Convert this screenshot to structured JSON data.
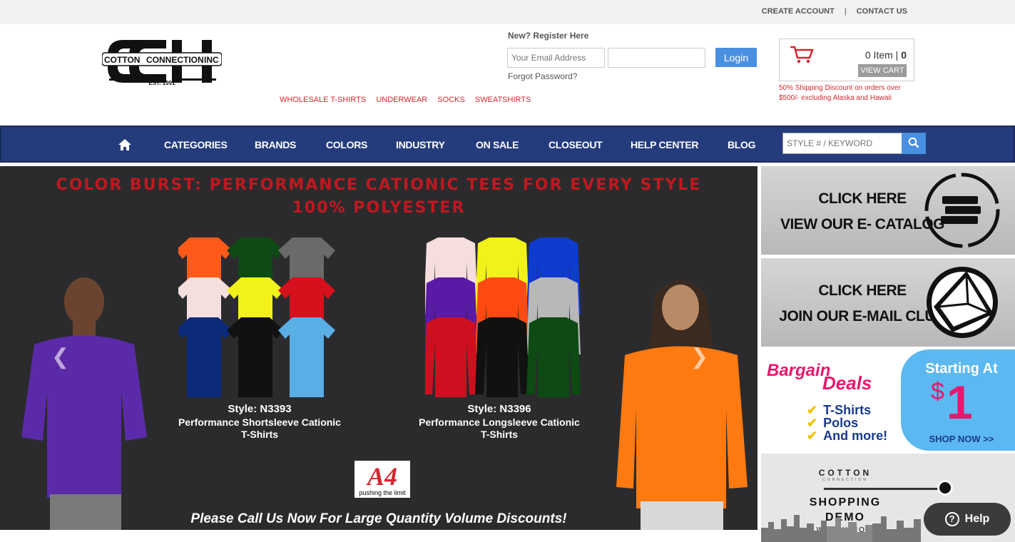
{
  "topbar": {
    "create_account": "CREATE ACCOUNT",
    "separator": "|",
    "contact_us": "CONTACT US"
  },
  "logo": {
    "brand_left": "COTTON",
    "brand_mid": "CONNECTION",
    "brand_right": "INC",
    "est": "EST. 1991"
  },
  "category_links": [
    "WHOLESALE T-SHIRTS",
    "UNDERWEAR",
    "SOCKS",
    "SWEATSHIRTS"
  ],
  "login": {
    "register_label": "New? Register Here",
    "email_placeholder": "Your Email Address",
    "password_placeholder": "",
    "login_label": "Login",
    "forgot_label": "Forgot Password?"
  },
  "cart": {
    "items_label": "0 Item |",
    "total": "0",
    "view_cart_label": "VIEW CART",
    "shipping_note": "50% Shipping Discount on orders over $500/- excluding Alaska and Hawaii"
  },
  "nav": {
    "items": [
      "CATEGORIES",
      "BRANDS",
      "COLORS",
      "INDUSTRY",
      "ON SALE",
      "CLOSEOUT",
      "HELP CENTER",
      "BLOG"
    ],
    "search_placeholder": "STYLE # / KEYWORD"
  },
  "hero": {
    "title_line1": "COLOR BURST: PERFORMANCE CATIONIC TEES FOR EVERY STYLE",
    "title_line2": "100% POLYESTER",
    "style1_label": "Style: N3393",
    "style1_desc": "Performance Shortsleeve Cationic T-Shirts",
    "style2_label": "Style: N3396",
    "style2_desc": "Performance Longsleeve Cationic T-Shirts",
    "brand_logo": "A4",
    "brand_tagline": "pushing the limit",
    "footer": "Please Call Us Now For Large Quantity Volume Discounts!",
    "shortsleeve_colors": [
      "#ff5a1a",
      "#0d4a14",
      "#6a6a6a",
      "#f4dede",
      "#f2f21a",
      "#d6101c",
      "#0b2a7a",
      "#111111",
      "#5aaee6"
    ],
    "longsleeve_colors": [
      "#f6dede",
      "#f2f21a",
      "#0d3ccf",
      "#5a1aa6",
      "#ff4a12",
      "#b8b8b8",
      "#cc1020",
      "#111111",
      "#0d4a14"
    ]
  },
  "promos": {
    "catalog": {
      "line1": "CLICK HERE",
      "line2": "VIEW OUR E- CATALOG"
    },
    "email_club": {
      "line1": "CLICK HERE",
      "line2": "JOIN OUR E-MAIL CLUB"
    },
    "bargain": {
      "title1": "Bargain",
      "title2": "Deals",
      "items": [
        "T-Shirts",
        "Polos",
        "And more!"
      ],
      "starting": "Starting At",
      "dollar": "$",
      "amount": "1",
      "shop_now": "SHOP NOW >>"
    },
    "demo": {
      "brand": "COTTON",
      "sub": "CONNECTION",
      "title_line1": "SHOPPING",
      "title_line2": "DEMO",
      "watch": "WATCH NOW"
    }
  },
  "help": {
    "label": "Help"
  },
  "colors": {
    "accent_red": "#d4262e",
    "nav_blue": "#243c7c",
    "button_blue": "#4a90e2"
  }
}
